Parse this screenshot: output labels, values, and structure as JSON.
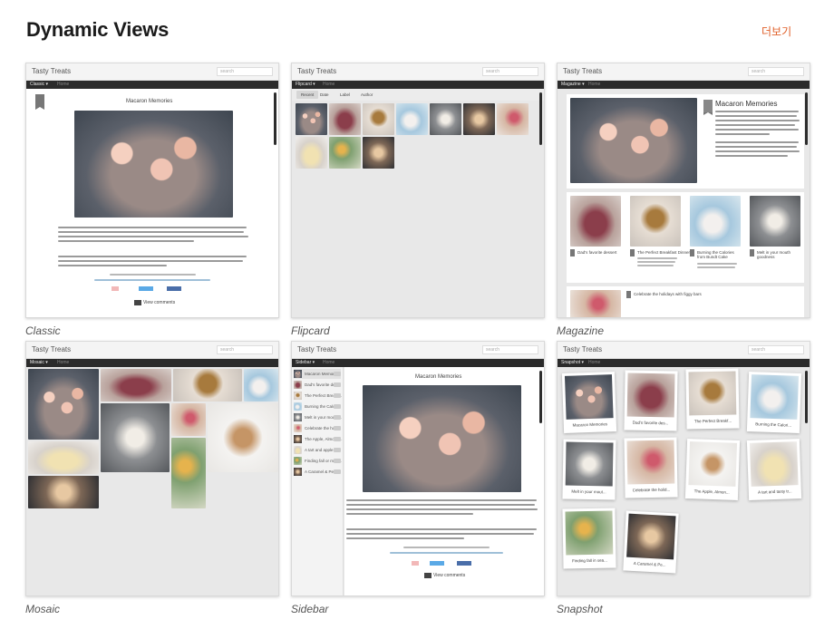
{
  "header": {
    "title": "Dynamic Views",
    "more_label": "더보기"
  },
  "blog": {
    "title": "Tasty Treats",
    "search_placeholder": "search",
    "home_label": "Home",
    "post_title": "Macaron Memories",
    "date_label": "Posted 12th December 2016 by Laura Soberman",
    "view_comments": "View comments",
    "flipcard_tabs": [
      "Recent",
      "Date",
      "Label",
      "Author"
    ]
  },
  "views": [
    {
      "id": "classic",
      "caption": "Classic",
      "selector": "Classic ▾"
    },
    {
      "id": "flipcard",
      "caption": "Flipcard",
      "selector": "Flipcard ▾"
    },
    {
      "id": "magazine",
      "caption": "Magazine",
      "selector": "Magazine ▾"
    },
    {
      "id": "mosaic",
      "caption": "Mosaic",
      "selector": "Mosaic ▾"
    },
    {
      "id": "sidebar",
      "caption": "Sidebar",
      "selector": "Sidebar ▾"
    },
    {
      "id": "snapshot",
      "caption": "Snapshot",
      "selector": "Snapshot ▾"
    }
  ],
  "magazine_posts": [
    {
      "title": "Dad's favorite dessert"
    },
    {
      "title": "The Perfect Breakfast Dinner"
    },
    {
      "title": "Burning the Calories from Bundt Cake"
    },
    {
      "title": "Melt in your mouth goodness"
    },
    {
      "title": "Celebrate the holidays with figgy bars"
    }
  ],
  "sidebar_posts": [
    {
      "title": "Macaron Memories"
    },
    {
      "title": "Dad's favorite de..."
    },
    {
      "title": "The Perfect Breakf..."
    },
    {
      "title": "Burning the Calo..."
    },
    {
      "title": "Melt in your mouth..."
    },
    {
      "title": "Celebrate the holi..."
    },
    {
      "title": "The Apple, Almond..."
    },
    {
      "title": "A tart and apple s..."
    },
    {
      "title": "Finding fall or mon..."
    },
    {
      "title": "A Caramel & Pe..."
    }
  ],
  "snapshot_posts": [
    {
      "title": "Macaron Memories"
    },
    {
      "title": "Dad's favorite des..."
    },
    {
      "title": "The Perfect Breakf..."
    },
    {
      "title": "Burning the Calori..."
    },
    {
      "title": "Melt in your mout..."
    },
    {
      "title": "Celebrate the holid..."
    },
    {
      "title": "The Apple, Almon..."
    },
    {
      "title": "A tart and tasty tr..."
    },
    {
      "title": "Finding fall in sea..."
    },
    {
      "title": "A Caramel & Pe..."
    }
  ]
}
